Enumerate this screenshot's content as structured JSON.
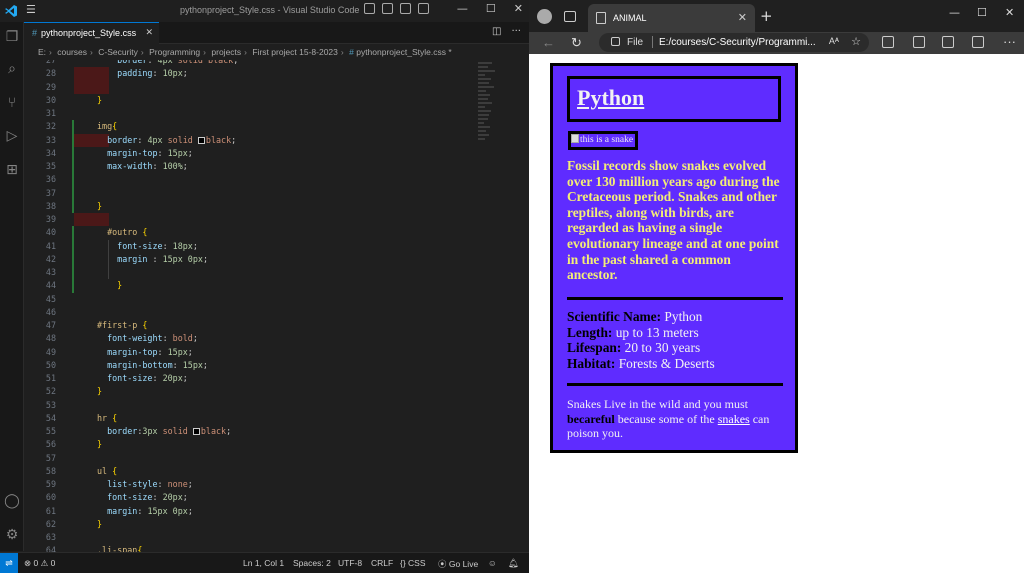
{
  "vscode": {
    "window_title": "pythonproject_Style.css - Visual Studio Code",
    "menu_icon": "hamburger-icon",
    "tab": {
      "label": "pythonproject_Style.css",
      "icon": "#"
    },
    "breadcrumb": [
      "E:",
      "courses",
      "C-Security",
      "Programming",
      "projects",
      "First project 15-8-2023",
      "pythonproject_Style.css",
      "*"
    ],
    "code_lines": [
      {
        "n": "27",
        "html": "    <span class='c-prop'>border</span><span class='c-punc'>: </span><span class='c-num'>4px</span> <span class='c-val'>solid</span> <span class='c-val'>black</span><span class='c-punc'>;</span>"
      },
      {
        "n": "28",
        "html": "    <span class='c-prop'>padding</span><span class='c-punc'>: </span><span class='c-num'>10px</span><span class='c-punc'>;</span>"
      },
      {
        "n": "29",
        "html": ""
      },
      {
        "n": "30",
        "html": "<span class='c-brace'>}</span>"
      },
      {
        "n": "31",
        "html": ""
      },
      {
        "n": "32",
        "html": "<span class='c-tag'>img</span><span class='c-brace'>{</span>"
      },
      {
        "n": "33",
        "html": "  <span class='c-prop'>border</span><span class='c-punc'>: </span><span class='c-num'>4px</span> <span class='c-val'>solid</span> <span class='swatch'></span><span class='c-val'>black</span><span class='c-punc'>;</span>"
      },
      {
        "n": "34",
        "html": "  <span class='c-prop'>margin-top</span><span class='c-punc'>: </span><span class='c-num'>15px</span><span class='c-punc'>;</span>"
      },
      {
        "n": "35",
        "html": "  <span class='c-prop'>max-width</span><span class='c-punc'>: </span><span class='c-num'>100%</span><span class='c-punc'>;</span>"
      },
      {
        "n": "36",
        "html": ""
      },
      {
        "n": "37",
        "html": ""
      },
      {
        "n": "38",
        "html": "<span class='c-brace'>}</span>"
      },
      {
        "n": "39",
        "html": ""
      },
      {
        "n": "40",
        "html": "  <span class='c-sel'>#outro</span> <span class='c-brace'>{</span>"
      },
      {
        "n": "41",
        "html": "    <span class='c-prop'>font-size</span><span class='c-punc'>: </span><span class='c-num'>18px</span><span class='c-punc'>;</span>"
      },
      {
        "n": "42",
        "html": "    <span class='c-prop'>margin</span> <span class='c-punc'>: </span><span class='c-num'>15px</span> <span class='c-num'>0px</span><span class='c-punc'>;</span>"
      },
      {
        "n": "43",
        "html": ""
      },
      {
        "n": "44",
        "html": "    <span class='c-brace'>}</span>"
      },
      {
        "n": "45",
        "html": ""
      },
      {
        "n": "46",
        "html": ""
      },
      {
        "n": "47",
        "html": "<span class='c-sel'>#first-p</span> <span class='c-brace'>{</span>"
      },
      {
        "n": "48",
        "html": "  <span class='c-prop'>font-weight</span><span class='c-punc'>: </span><span class='c-val'>bold</span><span class='c-punc'>;</span>"
      },
      {
        "n": "49",
        "html": "  <span class='c-prop'>margin-top</span><span class='c-punc'>: </span><span class='c-num'>15px</span><span class='c-punc'>;</span>"
      },
      {
        "n": "50",
        "html": "  <span class='c-prop'>margin-bottom</span><span class='c-punc'>: </span><span class='c-num'>15px</span><span class='c-punc'>;</span>"
      },
      {
        "n": "51",
        "html": "  <span class='c-prop'>font-size</span><span class='c-punc'>: </span><span class='c-num'>20px</span><span class='c-punc'>;</span>"
      },
      {
        "n": "52",
        "html": "<span class='c-brace'>}</span>"
      },
      {
        "n": "53",
        "html": ""
      },
      {
        "n": "54",
        "html": "<span class='c-tag'>hr</span> <span class='c-brace'>{</span>"
      },
      {
        "n": "55",
        "html": "  <span class='c-prop'>border</span><span class='c-punc'>:</span><span class='c-num'>3px</span> <span class='c-val'>solid</span> <span class='swatch'></span><span class='c-val'>black</span><span class='c-punc'>;</span>"
      },
      {
        "n": "56",
        "html": "<span class='c-brace'>}</span>"
      },
      {
        "n": "57",
        "html": ""
      },
      {
        "n": "58",
        "html": "<span class='c-tag'>ul</span> <span class='c-brace'>{</span>"
      },
      {
        "n": "59",
        "html": "  <span class='c-prop'>list-style</span><span class='c-punc'>: </span><span class='c-val'>none</span><span class='c-punc'>;</span>"
      },
      {
        "n": "60",
        "html": "  <span class='c-prop'>font-size</span><span class='c-punc'>: </span><span class='c-num'>20px</span><span class='c-punc'>;</span>"
      },
      {
        "n": "61",
        "html": "  <span class='c-prop'>margin</span><span class='c-punc'>: </span><span class='c-num'>15px</span> <span class='c-num'>0px</span><span class='c-punc'>;</span>"
      },
      {
        "n": "62",
        "html": "<span class='c-brace'>}</span>"
      },
      {
        "n": "63",
        "html": ""
      },
      {
        "n": "64",
        "html": "<span class='c-sel'>.li-span</span><span class='c-brace'>{</span>"
      }
    ],
    "status": {
      "problems": "0",
      "warnings": "0",
      "cursor": "Ln 1, Col 1",
      "spaces": "Spaces: 2",
      "encoding": "UTF-8",
      "eol": "CRLF",
      "language": "CSS",
      "golive": "Go Live"
    }
  },
  "edge": {
    "tab_title": "ANIMAL",
    "address_prefix": "File",
    "url": "E:/courses/C-Security/Programmi...",
    "page": {
      "title": "Python",
      "img_alt": "this is a snake",
      "first_p": "Fossil records show snakes evolved over 130 million years ago during the Cretaceous period. Snakes and other reptiles, along with birds, are regarded as having a single evolutionary lineage and at one point in the past shared a common ancestor.",
      "facts": [
        {
          "label": "Scientific Name:",
          "value": " Python"
        },
        {
          "label": "Length:",
          "value": " up to 13 meters"
        },
        {
          "label": "Lifespan:",
          "value": " 20 to 30 years"
        },
        {
          "label": "Habitat:",
          "value": " Forests & Deserts"
        }
      ],
      "outro_pre": "Snakes Live in the wild and you must ",
      "outro_bold": "becareful",
      "outro_mid": " because some of the ",
      "outro_link": "snakes",
      "outro_post": " can poison you.",
      "card_color": "#5f2cff",
      "first_p_color": "#f4ee76"
    }
  }
}
